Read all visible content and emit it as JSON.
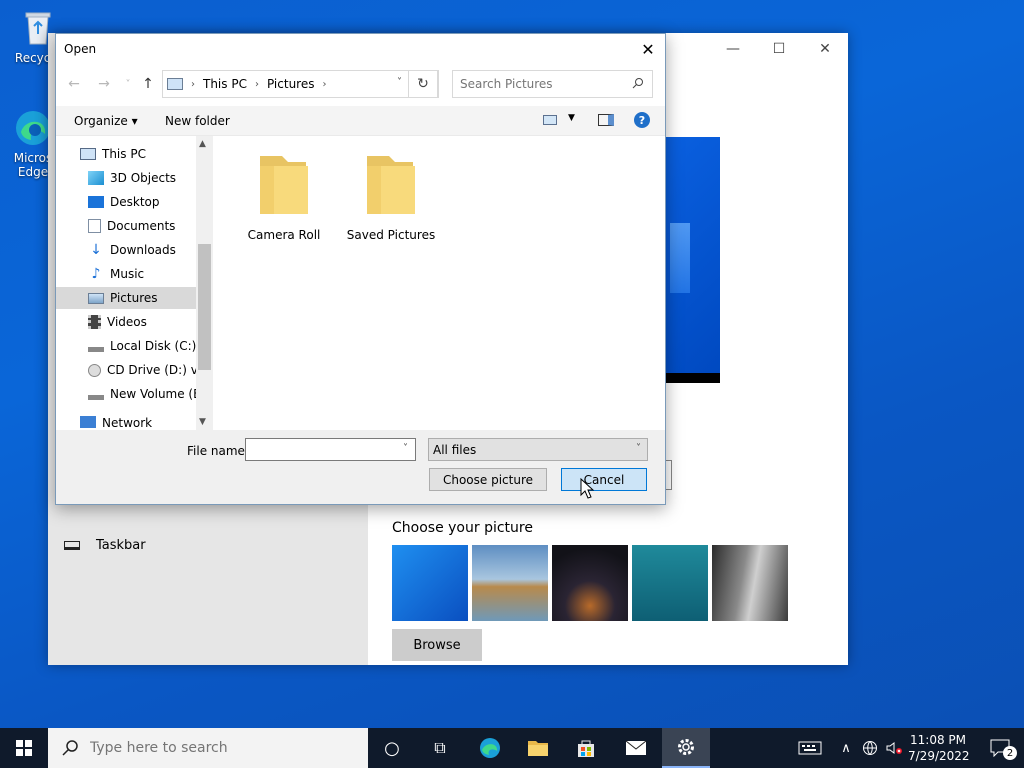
{
  "desktop": {
    "icons": [
      {
        "label": "Recycle",
        "icon": "recycle-bin-icon"
      },
      {
        "label": "Micros",
        "label2": "Edge",
        "icon": "edge-icon"
      }
    ]
  },
  "settings": {
    "choose_title": "Choose your picture",
    "browse_label": "Browse",
    "taskbar_label": "Taskbar",
    "minimize": "—",
    "maximize": "☐",
    "close": "✕"
  },
  "dialog": {
    "title": "Open",
    "close": "✕",
    "nav": {
      "back": "←",
      "forward": "→",
      "recent": "˅",
      "up": "↑"
    },
    "address": {
      "crumbs": [
        "This PC",
        "Pictures"
      ],
      "sep": "›",
      "dropdown": "˅",
      "refresh": "↻"
    },
    "search_placeholder": "Search Pictures",
    "toolbar": {
      "organize": "Organize ▾",
      "new_folder": "New folder",
      "view_dd": "▼",
      "help": "?"
    },
    "nav_pane": [
      {
        "label": "This PC",
        "icon": "pc-icon"
      },
      {
        "label": "3D Objects",
        "icon": "3d-objects-icon"
      },
      {
        "label": "Desktop",
        "icon": "desktop-icon"
      },
      {
        "label": "Documents",
        "icon": "documents-icon"
      },
      {
        "label": "Downloads",
        "icon": "downloads-icon"
      },
      {
        "label": "Music",
        "icon": "music-icon"
      },
      {
        "label": "Pictures",
        "icon": "pictures-icon",
        "selected": true
      },
      {
        "label": "Videos",
        "icon": "videos-icon"
      },
      {
        "label": "Local Disk (C:)",
        "icon": "local-disk-icon"
      },
      {
        "label": "CD Drive (D:) vir",
        "icon": "cd-drive-icon"
      },
      {
        "label": "New Volume (E:)",
        "icon": "volume-icon"
      },
      {
        "label": "Network",
        "icon": "network-icon"
      }
    ],
    "scroll": {
      "up": "▲",
      "down": "▼"
    },
    "files": [
      {
        "label": "Camera Roll",
        "icon": "folder-icon"
      },
      {
        "label": "Saved Pictures",
        "icon": "folder-icon"
      }
    ],
    "file_name_label": "File name:",
    "file_name_value": "",
    "file_dd": "˅",
    "filter_value": "All files",
    "choose_button": "Choose picture",
    "cancel_button": "Cancel"
  },
  "taskbar": {
    "search_placeholder": "Type here to search",
    "time": "11:08 PM",
    "date": "7/29/2022",
    "notifications": "2",
    "cortana": "○",
    "taskview": "⧉",
    "show_hidden": "∧"
  }
}
